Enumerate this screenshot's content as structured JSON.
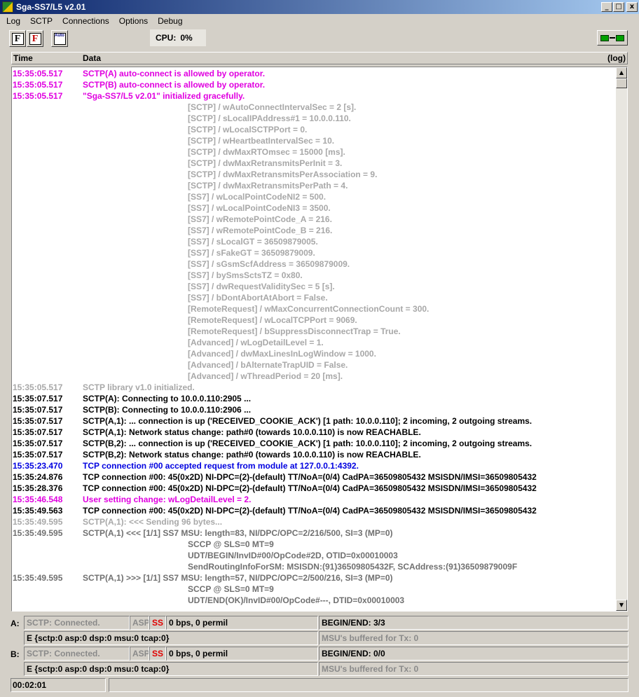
{
  "window": {
    "title": "Sga-SS7/L5  v2.01",
    "btn_min": "_",
    "btn_max": "□",
    "btn_close": "x"
  },
  "menu": [
    {
      "label": "Log"
    },
    {
      "label": "SCTP"
    },
    {
      "label": "Connections"
    },
    {
      "label": "Options"
    },
    {
      "label": "Debug"
    }
  ],
  "toolbar": {
    "btn1": "F",
    "btn2": "F",
    "btn3": "Auto",
    "cpu_label": "CPU:",
    "cpu_value": "0%"
  },
  "log": {
    "col_time": "Time",
    "col_data": "Data",
    "col_log": "(log)",
    "lines": [
      {
        "time": "15:35:05.517",
        "text": "SCTP(A) auto-connect is allowed by operator.",
        "color": "magenta"
      },
      {
        "time": "15:35:05.517",
        "text": "SCTP(B) auto-connect is allowed by operator.",
        "color": "magenta"
      },
      {
        "time": "15:35:05.517",
        "text": "\"Sga-SS7/L5  v2.01\" initialized gracefully.",
        "color": "magenta"
      },
      {
        "time": "",
        "text": "[SCTP] / wAutoConnectIntervalSec = 2 [s].",
        "color": "gray",
        "indent": true
      },
      {
        "time": "",
        "text": "[SCTP] / sLocalIPAddress#1 = 10.0.0.110.",
        "color": "gray",
        "indent": true
      },
      {
        "time": "",
        "text": "[SCTP] / wLocalSCTPPort = 0.",
        "color": "gray",
        "indent": true
      },
      {
        "time": "",
        "text": "[SCTP] / wHeartbeatIntervalSec = 10.",
        "color": "gray",
        "indent": true
      },
      {
        "time": "",
        "text": "[SCTP] / dwMaxRTOmsec = 15000 [ms].",
        "color": "gray",
        "indent": true
      },
      {
        "time": "",
        "text": "[SCTP] / dwMaxRetransmitsPerInit = 3.",
        "color": "gray",
        "indent": true
      },
      {
        "time": "",
        "text": "[SCTP] / dwMaxRetransmitsPerAssociation = 9.",
        "color": "gray",
        "indent": true
      },
      {
        "time": "",
        "text": "[SCTP] / dwMaxRetransmitsPerPath = 4.",
        "color": "gray",
        "indent": true
      },
      {
        "time": "",
        "text": "[SS7] / wLocalPointCodeNI2 = 500.",
        "color": "gray",
        "indent": true
      },
      {
        "time": "",
        "text": "[SS7] / wLocalPointCodeNI3 = 3500.",
        "color": "gray",
        "indent": true
      },
      {
        "time": "",
        "text": "[SS7] / wRemotePointCode_A = 216.",
        "color": "gray",
        "indent": true
      },
      {
        "time": "",
        "text": "[SS7] / wRemotePointCode_B = 216.",
        "color": "gray",
        "indent": true
      },
      {
        "time": "",
        "text": "[SS7] / sLocalGT = 36509879005.",
        "color": "gray",
        "indent": true
      },
      {
        "time": "",
        "text": "[SS7] / sFakeGT = 36509879009.",
        "color": "gray",
        "indent": true
      },
      {
        "time": "",
        "text": "[SS7] / sGsmScfAddress = 36509879009.",
        "color": "gray",
        "indent": true
      },
      {
        "time": "",
        "text": "[SS7] / bySmsSctsTZ = 0x80.",
        "color": "gray",
        "indent": true
      },
      {
        "time": "",
        "text": "[SS7] / dwRequestValiditySec = 5 [s].",
        "color": "gray",
        "indent": true
      },
      {
        "time": "",
        "text": "[SS7] / bDontAbortAtAbort = False.",
        "color": "gray",
        "indent": true
      },
      {
        "time": "",
        "text": "[RemoteRequest] / wMaxConcurrentConnectionCount = 300.",
        "color": "gray",
        "indent": true
      },
      {
        "time": "",
        "text": "[RemoteRequest] / wLocalTCPPort = 9069.",
        "color": "gray",
        "indent": true
      },
      {
        "time": "",
        "text": "[RemoteRequest] / bSuppressDisconnectTrap = True.",
        "color": "gray",
        "indent": true
      },
      {
        "time": "",
        "text": "[Advanced] / wLogDetailLevel = 1.",
        "color": "gray",
        "indent": true
      },
      {
        "time": "",
        "text": "[Advanced] / dwMaxLinesInLogWindow = 1000.",
        "color": "gray",
        "indent": true
      },
      {
        "time": "",
        "text": "[Advanced] / bAlternateTrapUID = False.",
        "color": "gray",
        "indent": true
      },
      {
        "time": "",
        "text": "[Advanced] / wThreadPeriod = 20 [ms].",
        "color": "gray",
        "indent": true
      },
      {
        "time": "15:35:05.517",
        "text": "SCTP library v1.0 initialized.",
        "color": "gray"
      },
      {
        "time": "15:35:07.517",
        "text": "SCTP(A): Connecting to 10.0.0.110:2905 ...",
        "color": "black"
      },
      {
        "time": "15:35:07.517",
        "text": "SCTP(B): Connecting to 10.0.0.110:2906 ...",
        "color": "black"
      },
      {
        "time": "15:35:07.517",
        "text": "SCTP(A,1): ... connection is up ('RECEIVED_COOKIE_ACK') [1 path: 10.0.0.110]; 2 incoming, 2 outgoing streams.",
        "color": "black"
      },
      {
        "time": "15:35:07.517",
        "text": "SCTP(A,1): Network status change: path#0 (towards 10.0.0.110) is now REACHABLE.",
        "color": "black"
      },
      {
        "time": "15:35:07.517",
        "text": "SCTP(B,2): ... connection is up ('RECEIVED_COOKIE_ACK') [1 path: 10.0.0.110]; 2 incoming, 2 outgoing streams.",
        "color": "black"
      },
      {
        "time": "15:35:07.517",
        "text": "SCTP(B,2): Network status change: path#0 (towards 10.0.0.110) is now REACHABLE.",
        "color": "black"
      },
      {
        "time": "15:35:23.470",
        "text": "TCP connection #00 accepted request from module at 127.0.0.1:4392.",
        "color": "blue"
      },
      {
        "time": "15:35:24.876",
        "text": "TCP connection #00: 45(0x2D) NI-DPC=(2)-(default) TT/NoA=(0/4) CadPA=36509805432 MSISDN/IMSI=36509805432",
        "color": "black"
      },
      {
        "time": "15:35:28.376",
        "text": "TCP connection #00: 45(0x2D) NI-DPC=(2)-(default) TT/NoA=(0/4) CadPA=36509805432 MSISDN/IMSI=36509805432",
        "color": "black"
      },
      {
        "time": "15:35:46.548",
        "text": "User setting change:  wLogDetailLevel = 2.",
        "color": "magenta"
      },
      {
        "time": "15:35:49.563",
        "text": "TCP connection #00: 45(0x2D) NI-DPC=(2)-(default) TT/NoA=(0/4) CadPA=36509805432 MSISDN/IMSI=36509805432",
        "color": "black"
      },
      {
        "time": "15:35:49.595",
        "text": "SCTP(A,1): <<< Sending 96 bytes...",
        "color": "gray"
      },
      {
        "time": "15:35:49.595",
        "text": "SCTP(A,1) <<< [1/1] SS7 MSU: length=83, NI/DPC/OPC=2/216/500, SI=3 (MP=0)",
        "color": "darkgray"
      },
      {
        "time": "",
        "text": "SCCP @ SLS=0 MT=9",
        "color": "darkgray",
        "indent": true
      },
      {
        "time": "",
        "text": "UDT/BEGIN/InvID#00/OpCode#2D, OTID=0x00010003",
        "color": "darkgray",
        "indent": true
      },
      {
        "time": "",
        "text": "SendRoutingInfoForSM: MSISDN:(91)36509805432F, SCAddress:(91)36509879009F",
        "color": "darkgray",
        "indent": true
      },
      {
        "time": "15:35:49.595",
        "text": "SCTP(A,1) >>> [1/1] SS7 MSU: length=57, NI/DPC/OPC=2/500/216, SI=3 (MP=0)",
        "color": "darkgray"
      },
      {
        "time": "",
        "text": "SCCP @ SLS=0 MT=9",
        "color": "darkgray",
        "indent": true
      },
      {
        "time": "",
        "text": "UDT/END(OK)/InvID#00/OpCode#---, DTID=0x00010003",
        "color": "darkgray",
        "indent": true
      }
    ]
  },
  "status": {
    "a": {
      "letter": "A:",
      "sctp": "SCTP:  Connected.",
      "asp": "ASP",
      "ss": "SS",
      "rate": "0 bps, 0 permil",
      "begin_end": "BEGIN/END: 3/3",
      "errors": "E {sctp:0  asp:0  dsp:0  msu:0  tcap:0}",
      "buffered": "MSU's buffered for Tx: 0"
    },
    "b": {
      "letter": "B:",
      "sctp": "SCTP:  Connected.",
      "asp": "ASP",
      "ss": "SS",
      "rate": "0 bps, 0 permil",
      "begin_end": "BEGIN/END: 0/0",
      "errors": "E {sctp:0  asp:0  dsp:0  msu:0  tcap:0}",
      "buffered": "MSU's buffered for Tx: 0"
    }
  },
  "footer": {
    "clock": "00:02:01"
  },
  "colors": {
    "magenta": "#e000e0",
    "gray": "#a8a8a8",
    "blue": "#0000e0",
    "black": "#000000",
    "darkgray": "#707070",
    "red": "#e00000"
  },
  "icons": {
    "app": "app-icon",
    "network": "network-status-icon",
    "scroll_up": "scroll-up-icon",
    "scroll_down": "scroll-down-icon"
  }
}
